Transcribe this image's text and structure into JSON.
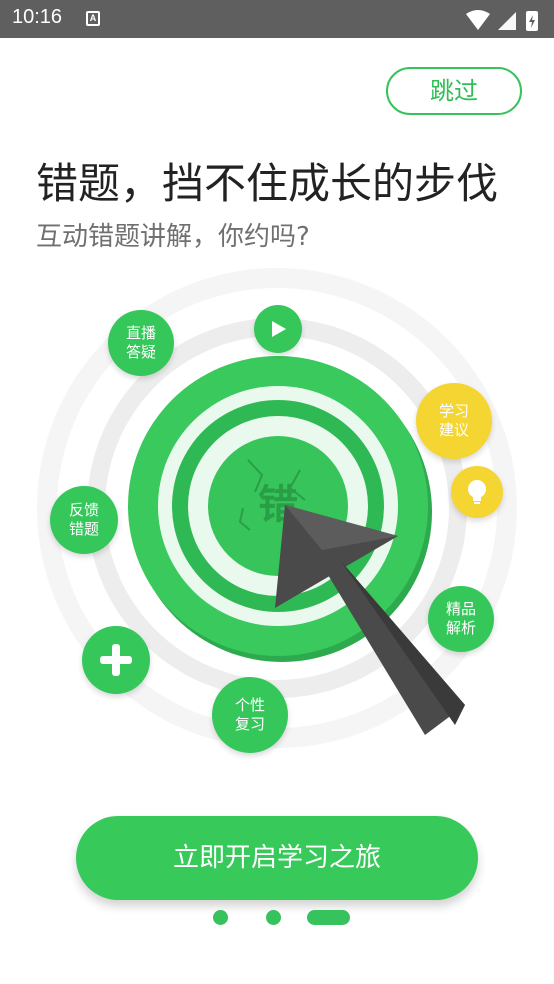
{
  "status_bar": {
    "time": "10:16",
    "notification_icon_letter": "A"
  },
  "skip_label": "跳过",
  "headline": "错题，挡不住成长的步伐",
  "subhead": "互动错题讲解，你约吗?",
  "target_center_text": "错",
  "bubbles": [
    {
      "line1": "直播",
      "line2": "答疑"
    },
    {
      "line1": "学习",
      "line2": "建议"
    },
    {
      "line1": "反馈",
      "line2": "错题"
    },
    {
      "line1": "精品",
      "line2": "解析"
    },
    {
      "line1": "个性",
      "line2": "复习"
    }
  ],
  "cta_label": "立即开启学习之旅",
  "pager": {
    "pages": 3,
    "active_index": 2
  },
  "colors": {
    "primary_green": "#36c25c",
    "yellow": "#f5d531",
    "dark_gray": "#4a4a4a"
  }
}
